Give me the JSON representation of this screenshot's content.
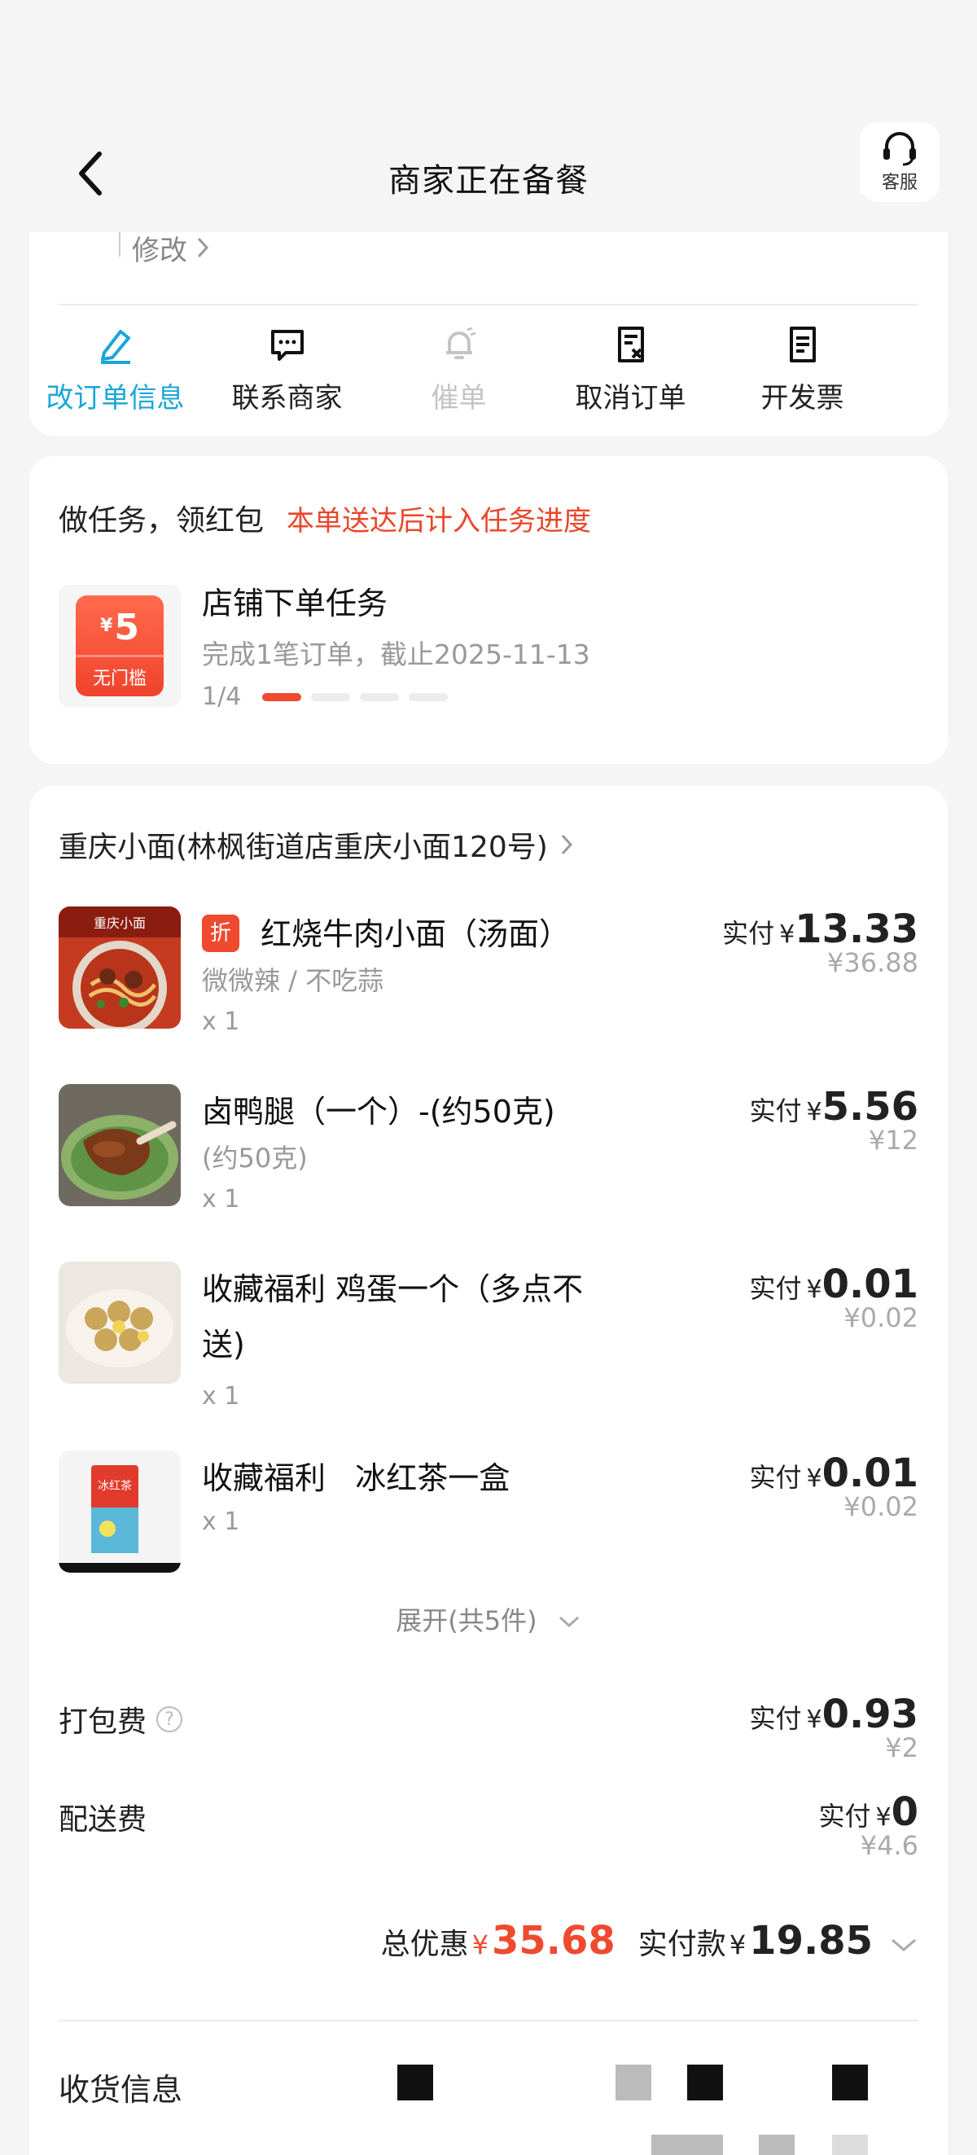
{
  "header": {
    "title": "商家正在备餐",
    "service_label": "客服"
  },
  "top_card": {
    "modify_label": "修改",
    "actions": [
      {
        "label": "改订单信息",
        "icon": "edit-icon"
      },
      {
        "label": "联系商家",
        "icon": "chat-icon"
      },
      {
        "label": "催单",
        "icon": "bell-icon"
      },
      {
        "label": "取消订单",
        "icon": "cancel-order-icon"
      },
      {
        "label": "开发票",
        "icon": "invoice-icon"
      }
    ]
  },
  "task_card": {
    "title": "做任务，领红包",
    "note": "本单送达后计入任务进度",
    "coupon_yen": "¥",
    "coupon_amount": "5",
    "coupon_tag": "无门槛",
    "task_name": "店铺下单任务",
    "task_desc": "完成1笔订单，截止2025-11-13",
    "progress_text": "1/4",
    "progress_value": 0.25
  },
  "order": {
    "shop_name": "重庆小面(林枫街道店重庆小面120号)",
    "items": [
      {
        "badge": "折",
        "name": "红烧牛肉小面（汤面）",
        "sub": "微微辣 / 不吃蒜",
        "qty": "x 1",
        "real_label": "实付",
        "yen": "¥",
        "real_price": "13.33",
        "orig_price": "¥36.88"
      },
      {
        "name": "卤鸭腿（一个）-(约50克)",
        "sub": "(约50克)",
        "qty": "x 1",
        "real_label": "实付",
        "yen": "¥",
        "real_price": "5.56",
        "orig_price": "¥12"
      },
      {
        "name_line1": "收藏福利 鸡蛋一个（多点不",
        "name_line2": "送)",
        "qty": "x 1",
        "real_label": "实付",
        "yen": "¥",
        "real_price": "0.01",
        "orig_price": "¥0.02"
      },
      {
        "name": "收藏福利   冰红茶一盒",
        "qty": "x 1",
        "real_label": "实付",
        "yen": "¥",
        "real_price": "0.01",
        "orig_price": "¥0.02"
      }
    ],
    "expand_label": "展开(共5件)",
    "fees": [
      {
        "label": "打包费",
        "real_label": "实付",
        "yen": "¥",
        "real_price": "0.93",
        "orig_price": "¥2"
      },
      {
        "label": "配送费",
        "real_label": "实付",
        "yen": "¥",
        "real_price": "0",
        "orig_price": "¥4.6"
      }
    ],
    "total_discount_label": "总优惠",
    "total_discount_yen": "¥",
    "total_discount": "35.68",
    "paid_label": "实付款",
    "paid_yen": "¥",
    "paid_amount": "19.85",
    "receive_label": "收货信息"
  },
  "colors": {
    "accent": "#1aa6d8",
    "red": "#ef4a30",
    "muted": "#999999"
  }
}
